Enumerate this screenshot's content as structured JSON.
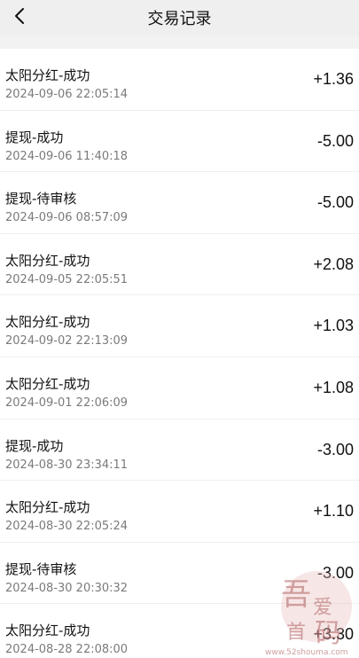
{
  "header": {
    "title": "交易记录",
    "back_icon": "chevron-left-icon"
  },
  "records": [
    {
      "name": "太阳分红-成功",
      "time": "2024-09-06 22:05:14",
      "amount": "+1.36"
    },
    {
      "name": "提现-成功",
      "time": "2024-09-06 11:40:18",
      "amount": "-5.00"
    },
    {
      "name": "提现-待审核",
      "time": "2024-09-06 08:57:09",
      "amount": "-5.00"
    },
    {
      "name": "太阳分红-成功",
      "time": "2024-09-05 22:05:51",
      "amount": "+2.08"
    },
    {
      "name": "太阳分红-成功",
      "time": "2024-09-02 22:13:09",
      "amount": "+1.03"
    },
    {
      "name": "太阳分红-成功",
      "time": "2024-09-01 22:06:09",
      "amount": "+1.08"
    },
    {
      "name": "提现-成功",
      "time": "2024-08-30 23:34:11",
      "amount": "-3.00"
    },
    {
      "name": "太阳分红-成功",
      "time": "2024-08-30 22:05:24",
      "amount": "+1.10"
    },
    {
      "name": "提现-待审核",
      "time": "2024-08-30 20:30:32",
      "amount": "-3.00"
    },
    {
      "name": "太阳分红-成功",
      "time": "2024-08-28 22:08:00",
      "amount": "+3.30"
    }
  ],
  "watermark": {
    "text": "吾爱首码",
    "url": "www.52shouma.com"
  }
}
